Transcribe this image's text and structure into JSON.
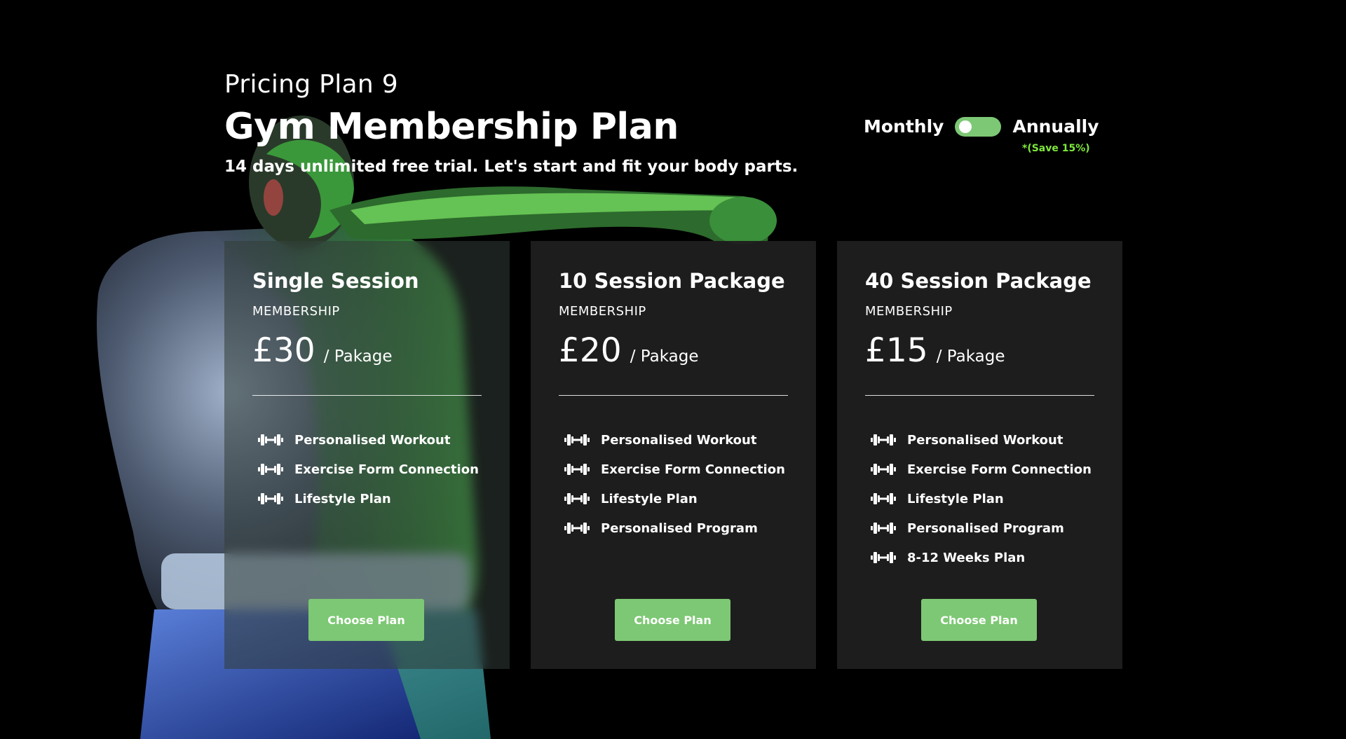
{
  "header": {
    "eyebrow": "Pricing Plan 9",
    "title": "Gym Membership Plan",
    "subtitle": "14 days unlimited free trial. Let's start and fit your body parts."
  },
  "billing": {
    "monthly_label": "Monthly",
    "annually_label": "Annually",
    "save_note": "*(Save 15%)",
    "selected": "Monthly"
  },
  "colors": {
    "accent": "#7dc874",
    "save_note": "#7ee83a",
    "card_bg": "#1e1e1e",
    "page_bg": "#000000"
  },
  "plans": [
    {
      "title": "Single Session",
      "subtitle": "MEMBERSHIP",
      "price": "£30",
      "per": "/ Pakage",
      "features": [
        {
          "icon": "dumbbell-icon",
          "label": "Personalised Workout"
        },
        {
          "icon": "dumbbell-icon",
          "label": "Exercise Form Connection"
        },
        {
          "icon": "dumbbell-icon",
          "label": "Lifestyle Plan"
        }
      ],
      "button_label": "Choose Plan"
    },
    {
      "title": "10 Session Package",
      "subtitle": "MEMBERSHIP",
      "price": "£20",
      "per": "/ Pakage",
      "features": [
        {
          "icon": "dumbbell-icon",
          "label": "Personalised Workout"
        },
        {
          "icon": "dumbbell-icon",
          "label": "Exercise Form Connection"
        },
        {
          "icon": "dumbbell-icon",
          "label": "Lifestyle Plan"
        },
        {
          "icon": "dumbbell-icon",
          "label": "Personalised Program"
        }
      ],
      "button_label": "Choose Plan"
    },
    {
      "title": "40 Session Package",
      "subtitle": "MEMBERSHIP",
      "price": "£15",
      "per": "/ Pakage",
      "features": [
        {
          "icon": "dumbbell-icon",
          "label": "Personalised Workout"
        },
        {
          "icon": "dumbbell-icon",
          "label": "Exercise Form Connection"
        },
        {
          "icon": "dumbbell-icon",
          "label": "Lifestyle Plan"
        },
        {
          "icon": "dumbbell-icon",
          "label": "Personalised Program"
        },
        {
          "icon": "dumbbell-icon",
          "label": "8-12 Weeks Plan"
        }
      ],
      "button_label": "Choose Plan"
    }
  ]
}
